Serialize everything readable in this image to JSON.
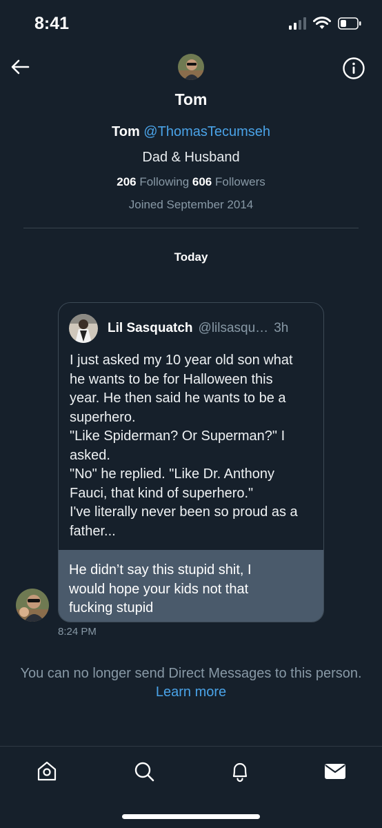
{
  "status_bar": {
    "time": "8:41"
  },
  "header": {
    "name": "Tom"
  },
  "profile": {
    "name": "Tom",
    "handle": "@ThomasTecumseh",
    "bio": "Dad & Husband",
    "following_count": "206",
    "following_label": "Following",
    "followers_count": "606",
    "followers_label": "Followers",
    "joined": "Joined September 2014"
  },
  "conversation": {
    "day_label": "Today",
    "message": {
      "quoted_tweet": {
        "author_name": "Lil Sasquatch",
        "author_handle": "@lilsasqu…",
        "age": "3h",
        "lines": [
          "I just asked my 10 year old son what",
          "he wants to be for Halloween this",
          "year. He then said he wants to be a",
          "superhero.",
          "\"Like Spiderman? Or Superman?\" I",
          "asked.",
          "\"No\" he replied. \"Like Dr. Anthony",
          "Fauci, that kind of superhero.\"",
          "I've literally never been so proud as a",
          "father..."
        ]
      },
      "reply_lines": [
        "He didn’t say this stupid shit, I",
        "would hope your kids not that",
        "fucking stupid"
      ],
      "time": "8:24 PM"
    },
    "notice": "You can no longer send Direct Messages to this person.",
    "learn_more": "Learn more"
  },
  "tabbar": {
    "icons": [
      "home-icon",
      "search-icon",
      "notifications-icon",
      "messages-icon"
    ],
    "active": "messages-icon"
  },
  "colors": {
    "background": "#16202b",
    "accent": "#4aa3e8",
    "muted": "#8899a6",
    "reply_bubble": "#4a5a6b"
  }
}
